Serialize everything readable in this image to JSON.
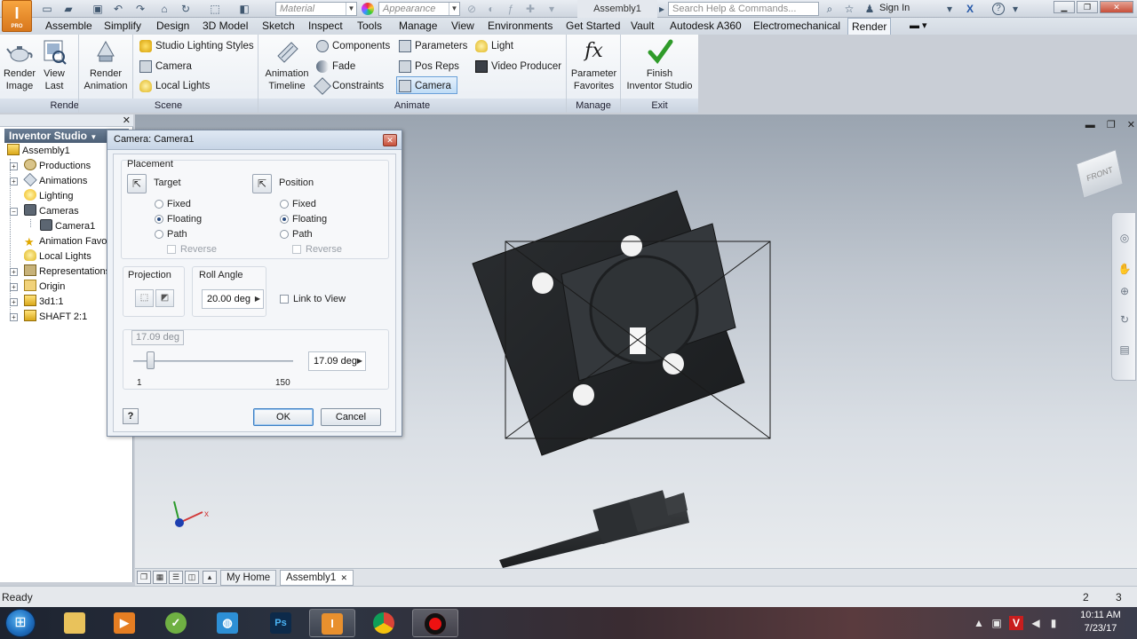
{
  "title_bar": {
    "app_logo": "I",
    "app_logo_sub": "PRO",
    "material_combo": "Material",
    "appearance_combo": "Appearance",
    "document_title": "Assembly1",
    "search_placeholder": "Search Help & Commands...",
    "sign_in": "Sign In"
  },
  "tabs": [
    "Assemble",
    "Simplify",
    "Design",
    "3D Model",
    "Sketch",
    "Inspect",
    "Tools",
    "Manage",
    "View",
    "Environments",
    "Get Started",
    "Vault",
    "Autodesk A360",
    "Electromechanical",
    "Render"
  ],
  "active_tab": "Render",
  "ribbon": {
    "render": {
      "title": "Render",
      "render_image": [
        "Render",
        "Image"
      ],
      "view_last": [
        "View",
        "Last"
      ]
    },
    "scene": {
      "title": "Scene",
      "render_animation": [
        "Render",
        "Animation"
      ],
      "studio_lighting_styles": "Studio Lighting Styles",
      "camera": "Camera",
      "local_lights": "Local Lights"
    },
    "animate": {
      "title": "Animate",
      "animation_timeline": [
        "Animation",
        "Timeline"
      ],
      "components": "Components",
      "fade": "Fade",
      "constraints": "Constraints",
      "parameters": "Parameters",
      "pos_reps": "Pos Reps",
      "camera": "Camera",
      "light": "Light",
      "video_producer": "Video Producer"
    },
    "manage": {
      "title": "Manage",
      "parameter_favorites": [
        "Parameter",
        "Favorites"
      ]
    },
    "exit": {
      "title": "Exit",
      "finish": [
        "Finish",
        "Inventor Studio"
      ]
    }
  },
  "browser": {
    "header": "Inventor Studio",
    "items": [
      {
        "label": "Assembly1",
        "icon": "assembly-icon"
      },
      {
        "label": "Productions",
        "icon": "productions-icon"
      },
      {
        "label": "Animations",
        "icon": "animations-icon"
      },
      {
        "label": "Lighting",
        "icon": "lighting-icon"
      },
      {
        "label": "Cameras",
        "icon": "cameras-icon"
      },
      {
        "label": "Camera1",
        "icon": "camera-icon"
      },
      {
        "label": "Animation Favori",
        "icon": "star-icon"
      },
      {
        "label": "Local Lights",
        "icon": "bulb-icon"
      },
      {
        "label": "Representations",
        "icon": "representations-icon"
      },
      {
        "label": "Origin",
        "icon": "folder-icon"
      },
      {
        "label": "3d1:1",
        "icon": "part-icon"
      },
      {
        "label": "SHAFT 2:1",
        "icon": "part-icon"
      }
    ]
  },
  "dialog": {
    "title": "Camera: Camera1",
    "placement_label": "Placement",
    "target_label": "Target",
    "position_label": "Position",
    "target_options": [
      "Fixed",
      "Floating",
      "Path"
    ],
    "target_selected": "Floating",
    "position_options": [
      "Fixed",
      "Floating",
      "Path"
    ],
    "position_selected": "Floating",
    "reverse_label": "Reverse",
    "projection_label": "Projection",
    "roll_angle_label": "Roll Angle",
    "roll_angle_value": "20.00 deg",
    "link_to_view_label": "Link to View",
    "fov_tooltip": "17.09 deg",
    "fov_value": "17.09 deg",
    "fov_position": 0.11,
    "slider_min": "1",
    "slider_max": "150",
    "help_label": "?",
    "ok_label": "OK",
    "cancel_label": "Cancel"
  },
  "viewport": {
    "viewcube_label": "FRONT"
  },
  "doc_tabs": {
    "my_home": "My Home",
    "assembly": "Assembly1"
  },
  "status": {
    "text": "Ready",
    "count_1": "2",
    "count_2": "3"
  },
  "taskbar": {
    "time": "10:11 AM",
    "date": "7/23/17"
  },
  "colors": {
    "ribbon_bg": "#f3f6fa",
    "dialog_bg": "#eef2f7",
    "active_btn": "#bfdcf6",
    "viewport_top": "#9aa4b0",
    "viewport_bottom": "#e8ebee"
  }
}
